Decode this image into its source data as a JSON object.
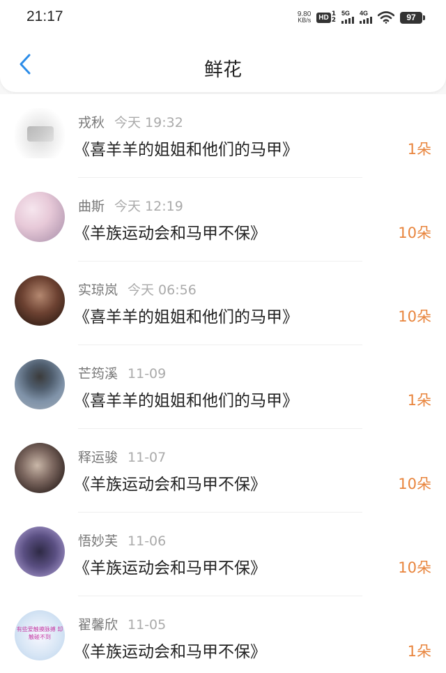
{
  "status_bar": {
    "time": "21:17",
    "net_speed_value": "9.80",
    "net_speed_unit": "KB/s",
    "hd_label": "HD",
    "hd_top": "1",
    "hd_bottom": "2",
    "signal1_label": "5G",
    "signal2_label": "4G",
    "battery": "97",
    "wifi_icon": "wifi-icon"
  },
  "header": {
    "back_icon": "chevron-left-icon",
    "title": "鲜花",
    "accent_color": "#2b8ce8"
  },
  "colors": {
    "count": "#e8843c",
    "name": "#777777",
    "time": "#aaaaaa"
  },
  "rows": [
    {
      "name": "戎秋",
      "time": "今天 19:32",
      "work": "《喜羊羊的姐姐和他们的马甲》",
      "count": "1朵"
    },
    {
      "name": "曲斯",
      "time": "今天 12:19",
      "work": "《羊族运动会和马甲不保》",
      "count": "10朵"
    },
    {
      "name": "实琼岚",
      "time": "今天 06:56",
      "work": "《喜羊羊的姐姐和他们的马甲》",
      "count": "10朵"
    },
    {
      "name": "芒筠溪",
      "time": "11-09",
      "work": "《喜羊羊的姐姐和他们的马甲》",
      "count": "1朵"
    },
    {
      "name": "释运骏",
      "time": "11-07",
      "work": "《羊族运动会和马甲不保》",
      "count": "10朵"
    },
    {
      "name": "悟妙芙",
      "time": "11-06",
      "work": "《羊族运动会和马甲不保》",
      "count": "10朵"
    },
    {
      "name": "翟馨欣",
      "time": "11-05",
      "work": "《羊族运动会和马甲不保》",
      "count": "1朵",
      "avatar_text": "有些爱触摸脉搏 却触碰不到"
    }
  ]
}
